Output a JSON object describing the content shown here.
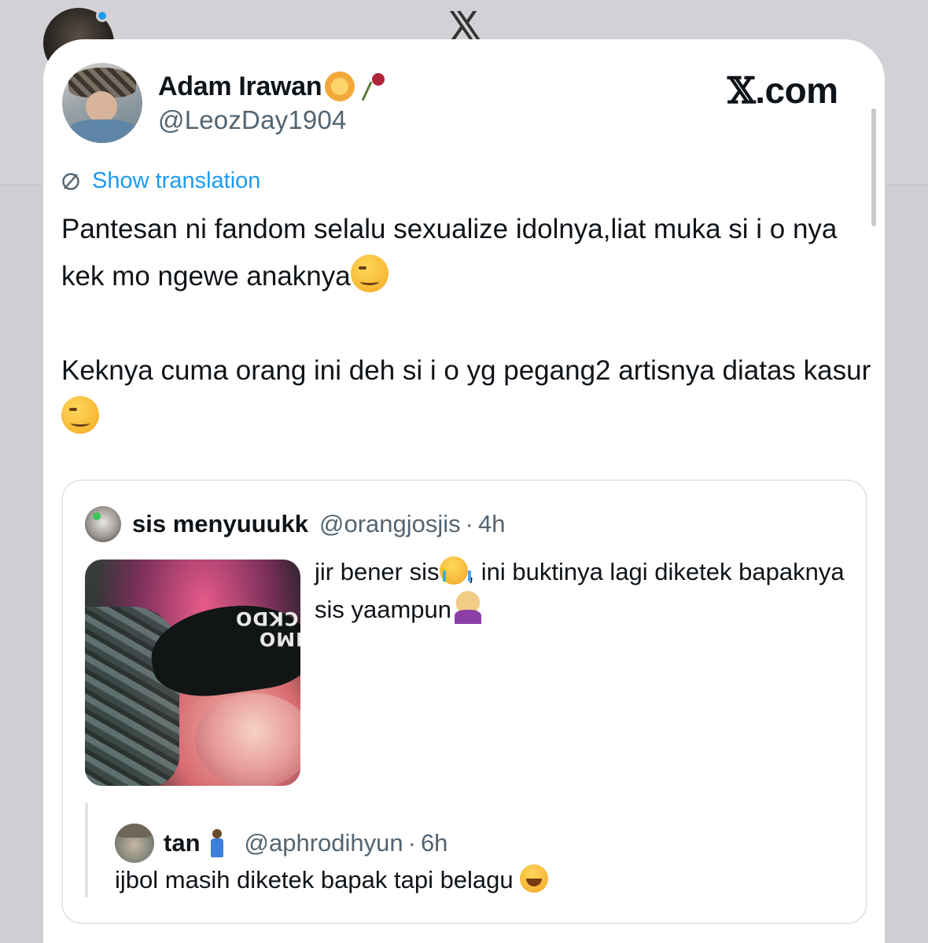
{
  "background": {
    "logo": "𝕏"
  },
  "tweet": {
    "author_name": "Adam Irawan",
    "author_emojis": [
      "lion-face-icon",
      "wilted-rose-icon"
    ],
    "author_handle": "@LeozDay1904",
    "brand": "X.com",
    "translate_label": "Show translation",
    "paragraph_1": "Pantesan ni fandom selalu sexualize idolnya,liat muka si i o nya kek mo ngewe anaknya",
    "paragraph_2": "Keknya cuma orang ini deh si i o yg pegang2 artisnya diatas kasur",
    "accent_color": "#1d9bf0"
  },
  "quote": {
    "name": "sis menyuuukk",
    "handle": "@orangjosjis",
    "separator": "·",
    "time": "4h",
    "text_part1": "jir bener sis",
    "text_part2": ", ini buktinya lagi diketek bapaknya sis yaampun",
    "media_cap_text": "MMO\nUCKDO"
  },
  "nested_quote": {
    "name": "tan",
    "handle": "@aphrodihyun",
    "separator": "·",
    "time": "6h",
    "text": "ijbol masih diketek bapak tapi belagu"
  }
}
